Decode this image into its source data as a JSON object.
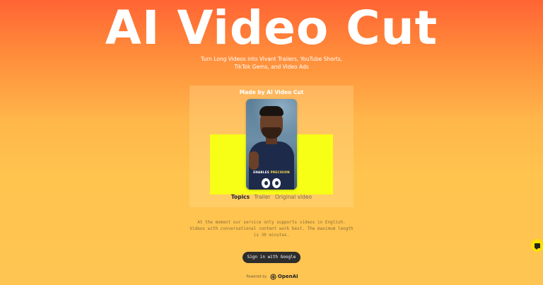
{
  "hero": {
    "title": "AI Video Cut",
    "subtitle": "Turn Long Videos into Vivant Trailers, YouTube Shorts, TikTok Gems, and Video Ads"
  },
  "demo": {
    "caption": "Made by AI Video Cut",
    "video_caption_prefix": "ENABLES ",
    "video_caption_highlight": "PRECISION",
    "tabs": [
      {
        "label": "Topics",
        "active": true
      },
      {
        "label": "Trailer",
        "active": false
      },
      {
        "label": "Original video",
        "active": false
      }
    ]
  },
  "notice": {
    "text": "At the moment our service only supports videos in English. Videos with conversational content work best. The maximum length is 30 minutes."
  },
  "auth": {
    "signin_label": "Sign in with Google"
  },
  "footer": {
    "powered_by": "Powered by",
    "brand": "OpenAI",
    "brand_icon": "openai-logo-icon"
  },
  "chat": {
    "icon": "chat-bubble-icon"
  },
  "colors": {
    "gradient_top": "#ff6434",
    "gradient_bottom": "#ffc552",
    "demo_highlight": "#f7ff16",
    "button_bg": "#2d2d2d",
    "chat_bg": "#ffe000"
  }
}
